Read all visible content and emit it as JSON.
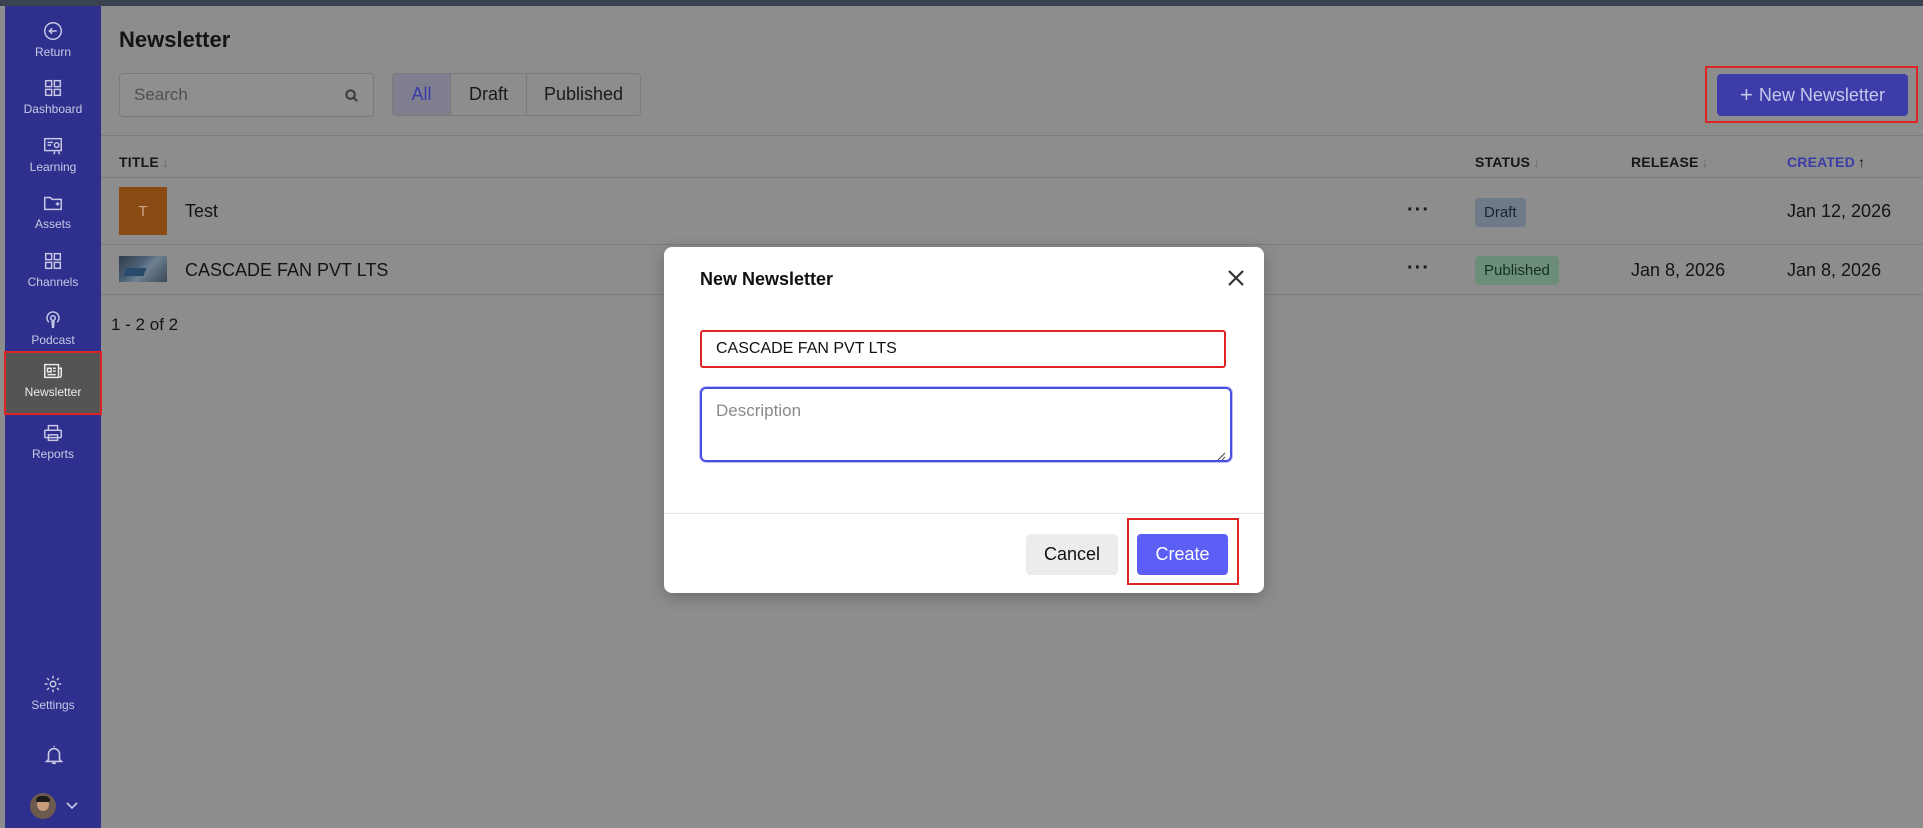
{
  "sidebar": {
    "items": [
      {
        "label": "Return",
        "icon": "return-icon"
      },
      {
        "label": "Dashboard",
        "icon": "dashboard-icon"
      },
      {
        "label": "Learning",
        "icon": "learning-icon"
      },
      {
        "label": "Assets",
        "icon": "assets-icon"
      },
      {
        "label": "Channels",
        "icon": "channels-icon"
      },
      {
        "label": "Podcast",
        "icon": "podcast-icon"
      },
      {
        "label": "Newsletter",
        "icon": "newsletter-icon",
        "active": true
      },
      {
        "label": "Reports",
        "icon": "reports-icon"
      }
    ],
    "settings_label": "Settings"
  },
  "page": {
    "title": "Newsletter",
    "search_placeholder": "Search",
    "filters": [
      "All",
      "Draft",
      "Published"
    ],
    "active_filter": "All",
    "new_button_label": "New Newsletter"
  },
  "table": {
    "columns": {
      "title": "TITLE",
      "status": "STATUS",
      "release": "RELEASE",
      "created": "CREATED"
    },
    "sorted_column": "CREATED",
    "rows": [
      {
        "thumb_letter": "T",
        "title": "Test",
        "status": "Draft",
        "release": "",
        "created": "Jan 12, 2026"
      },
      {
        "thumb_letter": "",
        "title": "CASCADE FAN PVT LTS",
        "status": "Published",
        "release": "Jan 8, 2026",
        "created": "Jan 8, 2026"
      }
    ],
    "pagination": "1 - 2 of 2",
    "more_label": "···"
  },
  "modal": {
    "title": "New Newsletter",
    "title_value": "CASCADE FAN PVT LTS",
    "description_placeholder": "Description",
    "cancel_label": "Cancel",
    "create_label": "Create"
  },
  "colors": {
    "sidebar_bg": "#2f2f8d",
    "accent": "#5b5ff5",
    "highlight": "#e02424"
  }
}
